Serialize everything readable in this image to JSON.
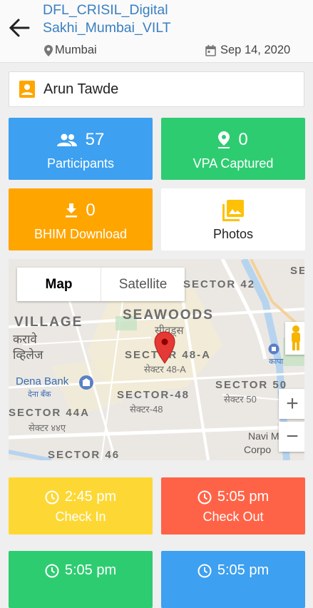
{
  "header": {
    "title": "DFL_CRISIL_Digital Sakhi_Mumbai_VILT",
    "location": "Mumbai",
    "date": "Sep 14, 2020"
  },
  "person": {
    "name": "Arun Tawde"
  },
  "tiles": {
    "participants": {
      "count": "57",
      "label": "Participants",
      "color": "#3da0f0"
    },
    "vpa": {
      "count": "0",
      "label": "VPA Captured",
      "color": "#2ecc71"
    },
    "bhim": {
      "count": "0",
      "label": "BHIM Download",
      "color": "#ffa500"
    },
    "photos": {
      "label": "Photos"
    }
  },
  "map": {
    "toggle_map": "Map",
    "toggle_satellite": "Satellite",
    "labels": {
      "sector42": "SECTOR 42",
      "village": "VILLAGE",
      "karave": "करावे",
      "village_hi": "व्हिलेज",
      "seawoods": "SEAWOODS",
      "seawoods_hi": "सीवूड्स",
      "sector48a": "SECTOR 48-A",
      "sector48a_hi": "सेक्टर 48-A",
      "dena": "Dena Bank",
      "dena_hi": "देना बँक",
      "sector48": "SECTOR-48",
      "sector48_hi": "सेक्टर-48",
      "sector50": "SECTOR 50",
      "sector50_hi": "सेक्टर 50",
      "sector44a": "SECTOR 44A",
      "sector44a_hi": "सेक्टर ४४ए",
      "sector46": "SECTOR 46",
      "navi": "Navi M",
      "corpo": "Corpo",
      "se": "SE",
      "kapa": "कापा"
    },
    "zoom_in": "+",
    "zoom_out": "−"
  },
  "checkin": {
    "time": "2:45 pm",
    "label": "Check In",
    "color": "#fdd835"
  },
  "checkout": {
    "time": "5:05 pm",
    "label": "Check Out",
    "color": "#ff6347"
  },
  "bottom_left": {
    "time": "5:05 pm",
    "color": "#2ecc71"
  },
  "bottom_right": {
    "time": "5:05 pm",
    "color": "#3da0f0"
  }
}
